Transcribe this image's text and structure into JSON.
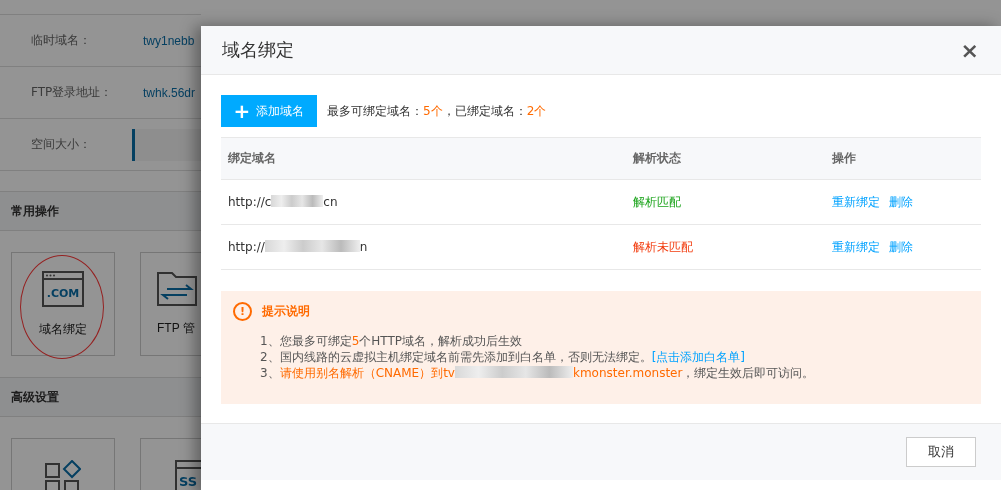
{
  "host_panel": {
    "info_rows": [
      {
        "label": "临时域名：",
        "value": "twy1nebb"
      },
      {
        "label": "FTP登录地址：",
        "value": "twhk.56dr"
      },
      {
        "label": "空间大小：",
        "kind": "field"
      }
    ],
    "sections": [
      {
        "title": "常用操作",
        "cards": [
          {
            "kind": "com",
            "icon_text": ".COM",
            "label": "域名绑定",
            "circled": true
          },
          {
            "kind": "folder-transfer",
            "label": "FTP 管"
          }
        ]
      },
      {
        "title": "高级设置",
        "cards": [
          {
            "kind": "grid"
          },
          {
            "kind": "ssl",
            "icon_text": "SS"
          }
        ]
      }
    ]
  },
  "dialog": {
    "title": "域名绑定",
    "close": "×",
    "add_button": {
      "icon": "+",
      "label": "添加域名"
    },
    "quota": [
      {
        "kind": "plain",
        "text": "最多可绑定域名："
      },
      {
        "kind": "accent",
        "text": "5个"
      },
      {
        "kind": "plain",
        "text": "，已绑定域名："
      },
      {
        "kind": "accent",
        "text": "2个"
      }
    ],
    "table": {
      "columns": [
        "绑定域名",
        "解析状态",
        "操作"
      ],
      "rows": [
        {
          "domain": [
            {
              "kind": "plain",
              "text": "http://c"
            },
            {
              "kind": "redacted"
            },
            {
              "kind": "plain",
              "text": "cn"
            }
          ],
          "status": {
            "kind": "ok",
            "text": "解析匹配"
          },
          "actions": [
            "重新绑定",
            "删除"
          ]
        },
        {
          "domain": [
            {
              "kind": "plain",
              "text": "http://"
            },
            {
              "kind": "redacted"
            },
            {
              "kind": "plain",
              "text": "n"
            }
          ],
          "status": {
            "kind": "error",
            "text": "解析未匹配"
          },
          "actions": [
            "重新绑定",
            "删除"
          ]
        }
      ]
    },
    "notice": {
      "icon": "!",
      "title": "提示说明",
      "lines": [
        [
          {
            "kind": "plain",
            "text": "1、您最多可绑定"
          },
          {
            "kind": "accent",
            "text": "5"
          },
          {
            "kind": "plain",
            "text": "个HTTP域名，解析成功后生效"
          }
        ],
        [
          {
            "kind": "plain",
            "text": "2、国内线路的云虚拟主机绑定域名前需先添加到白名单，否则无法绑定。"
          },
          {
            "kind": "link",
            "text": "[点击添加白名单]"
          }
        ],
        [
          {
            "kind": "plain",
            "text": "3、"
          },
          {
            "kind": "accent",
            "text": "请使用别名解析（CNAME）到tv"
          },
          {
            "kind": "redacted"
          },
          {
            "kind": "accent",
            "text": "kmonster.monster"
          },
          {
            "kind": "plain",
            "text": "，绑定生效后即可访问。"
          }
        ]
      ]
    },
    "footer_button": "取消"
  }
}
